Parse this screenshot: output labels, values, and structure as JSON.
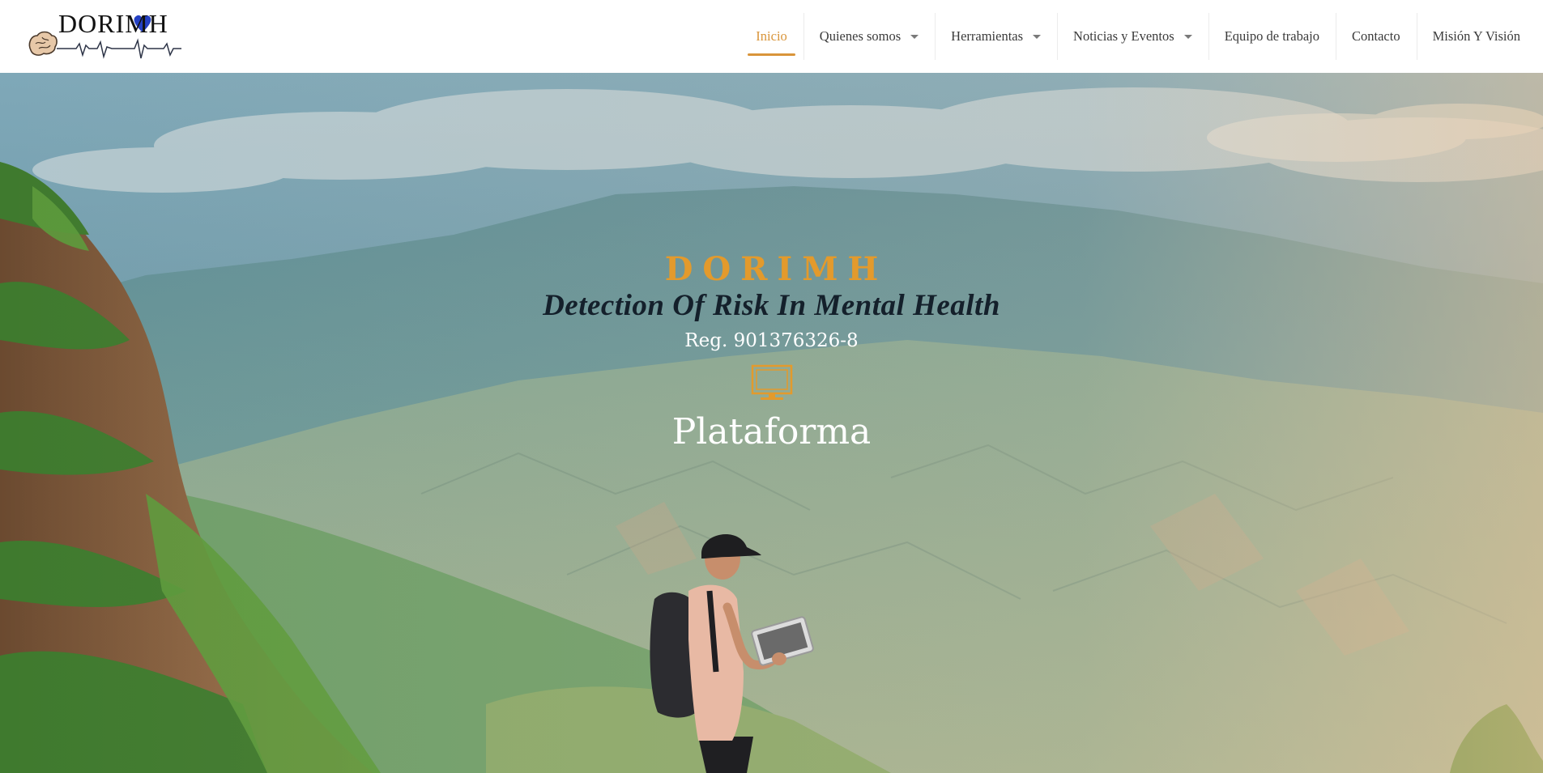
{
  "logo": {
    "text": "DORIMH",
    "icon": "brain-heartbeat-logo"
  },
  "nav": {
    "items": [
      {
        "label": "Inicio",
        "active": true,
        "dropdown": false
      },
      {
        "label": "Quienes somos",
        "active": false,
        "dropdown": true
      },
      {
        "label": "Herramientas",
        "active": false,
        "dropdown": true
      },
      {
        "label": "Noticias y Eventos",
        "active": false,
        "dropdown": true
      },
      {
        "label": "Equipo de trabajo",
        "active": false,
        "dropdown": false
      },
      {
        "label": "Contacto",
        "active": false,
        "dropdown": false
      },
      {
        "label": "Misión Y Visión",
        "active": false,
        "dropdown": false
      }
    ]
  },
  "hero": {
    "brand": "DORIMH",
    "tagline": "Detection Of Risk In Mental Health",
    "registration": "Reg. 901376326-8",
    "icon": "monitor-icon",
    "platform_label": "Plataforma"
  },
  "colors": {
    "accent": "#d9953a",
    "brand": "#e39a2c",
    "nav_text": "#3b3b3b",
    "tagline": "#14202b",
    "logo_blue": "#2541c4"
  }
}
